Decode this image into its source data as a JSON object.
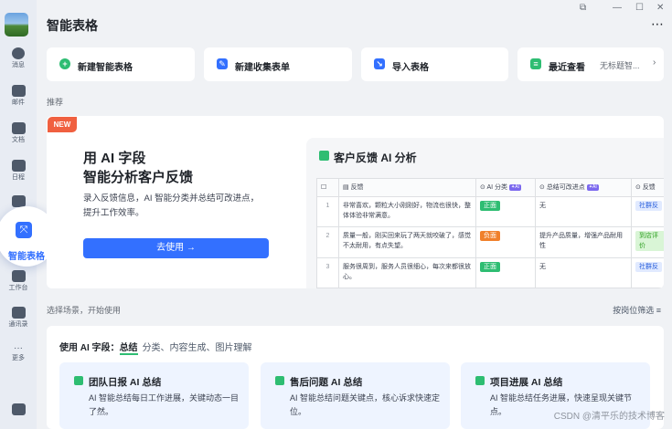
{
  "sidebar": {
    "items": [
      {
        "label": "消息"
      },
      {
        "label": "邮件"
      },
      {
        "label": "文档"
      },
      {
        "label": "日程"
      },
      {
        "label": "智能表格"
      },
      {
        "label": "工作台"
      },
      {
        "label": "通讯录"
      },
      {
        "label": "更多"
      }
    ]
  },
  "header": {
    "title": "智能表格",
    "more": "⋯"
  },
  "quick_actions": [
    {
      "label": "新建智能表格",
      "icon": "plus-circle-icon",
      "color": "#2ebd72"
    },
    {
      "label": "新建收集表单",
      "icon": "form-icon",
      "color": "#3370ff"
    },
    {
      "label": "导入表格",
      "icon": "import-icon",
      "color": "#3370ff"
    },
    {
      "label": "最近查看",
      "icon": "recent-icon",
      "color": "#2ebd72",
      "extra": "无标题智..."
    }
  ],
  "recommend": {
    "label": "推荐"
  },
  "banner": {
    "tag": "NEW",
    "title_line1": "用 AI 字段",
    "title_line2": "智能分析客户反馈",
    "desc": "录入反馈信息，AI 智能分类并总结可改进点，提升工作效率。",
    "button": "去使用 →",
    "preview_title": "客户反馈 AI 分析",
    "table": {
      "headers": [
        "反馈",
        "AI 分类",
        "总结可改进点",
        "反馈"
      ],
      "rows": [
        {
          "no": "1",
          "feedback": "非常喜欢，颗粒大小刚刚好，物流也很快，整体体验非常满意。",
          "category": "正面",
          "summary": "无",
          "extra": "社群反"
        },
        {
          "no": "2",
          "feedback": "质量一般，刚买回来玩了两天就咬破了，感觉不太耐用，有点失望。",
          "category": "负面",
          "summary": "提升产品质量，增强产品耐用性",
          "extra": "到店评价"
        },
        {
          "no": "3",
          "feedback": "服务很周到，服务人员很细心，每次来都很放心。",
          "category": "正面",
          "summary": "无",
          "extra": "社群反"
        }
      ]
    }
  },
  "scenes": {
    "label": "选择场景，开始使用",
    "filter": "按岗位筛选 ≡",
    "use_prefix": "使用 AI 字段：",
    "tabs": [
      "总结",
      "分类、内容生成、图片理解"
    ],
    "cards": [
      {
        "title": "团队日报 AI 总结",
        "desc": "AI 智能总结每日工作进展，关键动态一目了然。"
      },
      {
        "title": "售后问题 AI 总结",
        "desc": "AI 智能总结问题关键点，核心诉求快速定位。"
      },
      {
        "title": "项目进展 AI 总结",
        "desc": "AI 智能总结任务进展，快速呈现关键节点。"
      }
    ]
  },
  "watermark": "CSDN @清平乐的技术博客",
  "colors": {
    "accent": "#3370ff",
    "positive": "#2ebd72",
    "negative": "#f0802b",
    "new_tag": "#f06040"
  }
}
